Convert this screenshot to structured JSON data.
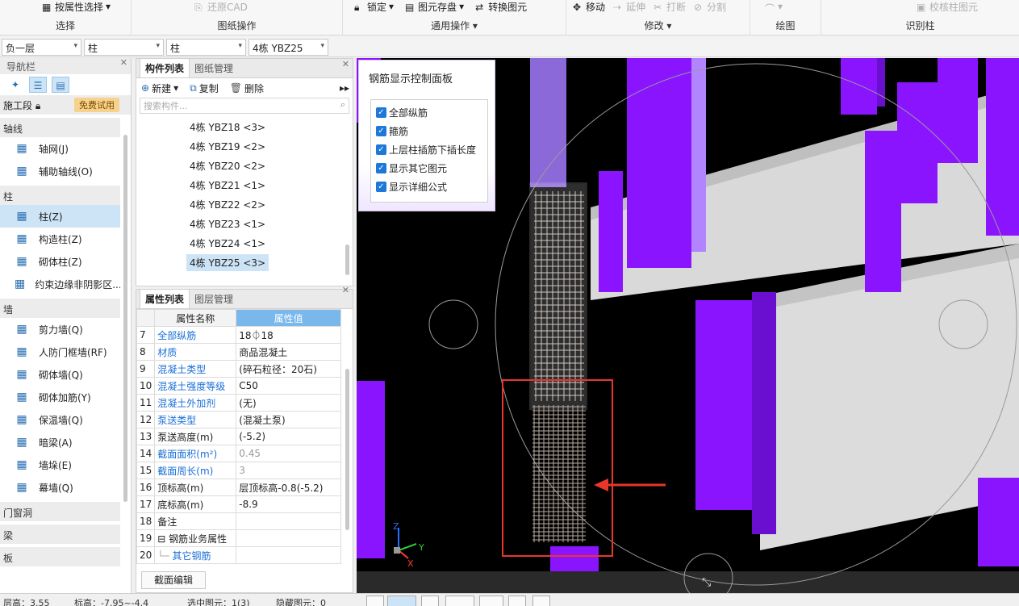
{
  "ribbon": {
    "groups": [
      {
        "name": "选择",
        "items": [
          "按属性选择"
        ]
      },
      {
        "name": "图纸操作",
        "items": [
          "还原CAD"
        ]
      },
      {
        "name": "通用操作",
        "items": [
          "锁定",
          "图元存盘",
          "转换图元"
        ]
      },
      {
        "name": "修改",
        "items": [
          "移动",
          "延伸",
          "打断",
          "分割"
        ]
      },
      {
        "name": "绘图",
        "items": []
      },
      {
        "name": "识别柱",
        "items": [
          "校核柱图元"
        ]
      }
    ]
  },
  "dropdowns": [
    "负一层",
    "柱",
    "柱",
    "4栋 YBZ25"
  ],
  "nav": {
    "title": "导航栏",
    "stage_label": "施工段",
    "stage_badge": "免费试用",
    "categories": [
      {
        "name": "轴线",
        "items": [
          {
            "label": "轴网(J)",
            "icon": "grid-icon"
          },
          {
            "label": "辅助轴线(O)",
            "icon": "aux-axis-icon"
          }
        ]
      },
      {
        "name": "柱",
        "items": [
          {
            "label": "柱(Z)",
            "icon": "column-icon",
            "selected": true
          },
          {
            "label": "构造柱(Z)",
            "icon": "construct-column-icon"
          },
          {
            "label": "砌体柱(Z)",
            "icon": "masonry-column-icon"
          },
          {
            "label": "约束边缘非阴影区...",
            "icon": "constraint-edge-icon"
          }
        ]
      },
      {
        "name": "墙",
        "items": [
          {
            "label": "剪力墙(Q)",
            "icon": "shear-wall-icon"
          },
          {
            "label": "人防门框墙(RF)",
            "icon": "civil-defense-wall-icon"
          },
          {
            "label": "砌体墙(Q)",
            "icon": "masonry-wall-icon"
          },
          {
            "label": "砌体加筋(Y)",
            "icon": "masonry-rebar-icon"
          },
          {
            "label": "保温墙(Q)",
            "icon": "insulation-wall-icon"
          },
          {
            "label": "暗梁(A)",
            "icon": "hidden-beam-icon"
          },
          {
            "label": "墙垛(E)",
            "icon": "wall-pier-icon"
          },
          {
            "label": "幕墙(Q)",
            "icon": "curtain-wall-icon"
          }
        ]
      },
      {
        "name": "门窗洞",
        "items": []
      },
      {
        "name": "梁",
        "items": []
      },
      {
        "name": "板",
        "items": []
      }
    ]
  },
  "component_panel": {
    "tabs": [
      "构件列表",
      "图纸管理"
    ],
    "tools": [
      "新建",
      "复制",
      "删除"
    ],
    "search_placeholder": "搜索构件...",
    "items": [
      "4栋 YBZ18 <3>",
      "4栋 YBZ19 <2>",
      "4栋 YBZ20 <2>",
      "4栋 YBZ21 <1>",
      "4栋 YBZ22 <2>",
      "4栋 YBZ23 <1>",
      "4栋 YBZ24 <1>",
      "4栋 YBZ25 <3>"
    ],
    "selected_index": 7
  },
  "property_panel": {
    "tabs": [
      "属性列表",
      "图层管理"
    ],
    "header": {
      "name": "属性名称",
      "value": "属性值"
    },
    "rows": [
      {
        "no": "7",
        "name": "全部纵筋",
        "value": "18⏀18",
        "blue": true
      },
      {
        "no": "8",
        "name": "材质",
        "value": "商品混凝土",
        "blue": true
      },
      {
        "no": "9",
        "name": "混凝土类型",
        "value": "(碎石粒径：20石)",
        "blue": true
      },
      {
        "no": "10",
        "name": "混凝土强度等级",
        "value": "C50",
        "blue": true
      },
      {
        "no": "11",
        "name": "混凝土外加剂",
        "value": "(无)",
        "blue": true
      },
      {
        "no": "12",
        "name": "泵送类型",
        "value": "(混凝土泵)",
        "blue": true
      },
      {
        "no": "13",
        "name": "泵送高度(m)",
        "value": "(-5.2)",
        "blue": false
      },
      {
        "no": "14",
        "name": "截面面积(m²)",
        "value": "0.45",
        "blue": true,
        "grey": true
      },
      {
        "no": "15",
        "name": "截面周长(m)",
        "value": "3",
        "blue": true,
        "grey": true
      },
      {
        "no": "16",
        "name": "顶标高(m)",
        "value": "层顶标高-0.8(-5.2)",
        "blue": false
      },
      {
        "no": "17",
        "name": "底标高(m)",
        "value": "-8.9",
        "blue": false
      },
      {
        "no": "18",
        "name": "备注",
        "value": "",
        "blue": false
      },
      {
        "no": "19",
        "name": "钢筋业务属性",
        "value": "",
        "blue": false,
        "group": true
      },
      {
        "no": "20",
        "name": "其它钢筋",
        "value": "",
        "blue": true,
        "child": true
      }
    ],
    "section_edit_button": "截面编辑"
  },
  "rebar_panel": {
    "title": "钢筋显示控制面板",
    "options": [
      "全部纵筋",
      "箍筋",
      "上层柱插筋下插长度",
      "显示其它图元",
      "显示详细公式"
    ]
  },
  "axes": {
    "x": "X",
    "y": "Y",
    "z": "Z"
  },
  "status": {
    "floor_height": "层高：3.55",
    "elevation": "标高：-7.95~-4.4",
    "selected": "选中图元：1(3)",
    "hidden": "隐藏图元：0"
  }
}
